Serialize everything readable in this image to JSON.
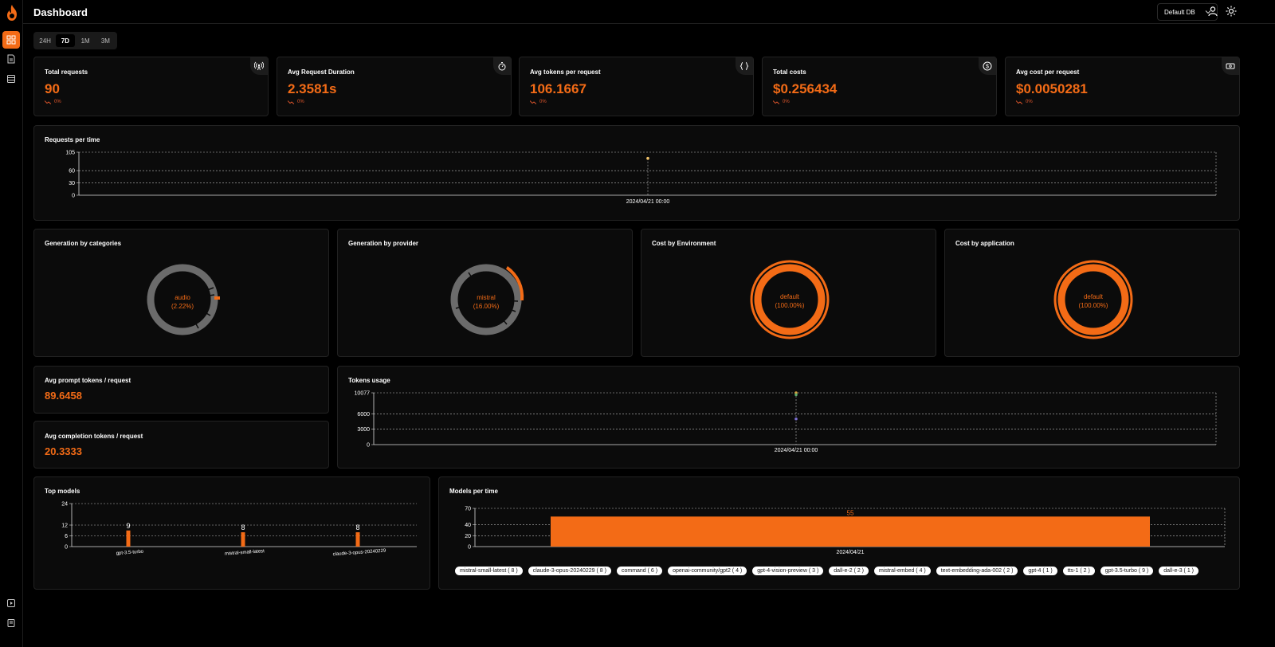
{
  "header": {
    "title": "Dashboard",
    "db_select": "Default DB"
  },
  "time_ranges": [
    {
      "label": "24H",
      "active": false
    },
    {
      "label": "7D",
      "active": true
    },
    {
      "label": "1M",
      "active": false
    },
    {
      "label": "3M",
      "active": false
    }
  ],
  "stats": [
    {
      "title": "Total requests",
      "value": "90",
      "change": "0%",
      "icon": "broadcast-icon"
    },
    {
      "title": "Avg Request Duration",
      "value": "2.3581s",
      "change": "0%",
      "icon": "stopwatch-icon"
    },
    {
      "title": "Avg tokens per request",
      "value": "106.1667",
      "change": "0%",
      "icon": "braces-icon"
    },
    {
      "title": "Total costs",
      "value": "$0.256434",
      "change": "0%",
      "icon": "dollar-icon"
    },
    {
      "title": "Avg cost per request",
      "value": "$0.0050281",
      "change": "0%",
      "icon": "cash-icon"
    }
  ],
  "requests_chart": {
    "title": "Requests per time"
  },
  "donuts": [
    {
      "title": "Generation by categories",
      "label": "audio",
      "pct": "(2.22%)"
    },
    {
      "title": "Generation by provider",
      "label": "mistral",
      "pct": "(16.00%)"
    },
    {
      "title": "Cost by Environment",
      "label": "default",
      "pct": "(100.00%)"
    },
    {
      "title": "Cost by application",
      "label": "default",
      "pct": "(100.00%)"
    }
  ],
  "avg_prompt": {
    "title": "Avg prompt tokens / request",
    "value": "89.6458"
  },
  "avg_completion": {
    "title": "Avg completion tokens / request",
    "value": "20.3333"
  },
  "tokens_chart": {
    "title": "Tokens usage"
  },
  "top_models_title": "Top models",
  "models_per_time_title": "Models per time",
  "models_tags": [
    "mistral-small-latest ( 8 )",
    "claude-3-opus-20240229 ( 8 )",
    "command ( 6 )",
    "openai-community/gpt2 ( 4 )",
    "gpt-4-vision-preview ( 3 )",
    "dall-e-2 ( 2 )",
    "mistral-embed ( 4 )",
    "text-embedding-ada-002 ( 2 )",
    "gpt-4 ( 1 )",
    "tts-1 ( 2 )",
    "gpt-3.5-turbo ( 9 )",
    "dall-e-3 ( 1 )"
  ],
  "colors": {
    "accent": "#f36b16",
    "bg": "#000000",
    "card": "#0b0b0b",
    "muted": "#6b6b6b"
  },
  "chart_data": [
    {
      "type": "scatter",
      "title": "Requests per time",
      "x": [
        "2024/04/21 00:00"
      ],
      "y_ticks": [
        0,
        30,
        60,
        105
      ],
      "ylim": [
        0,
        105
      ],
      "series": [
        {
          "values": [
            90
          ]
        }
      ],
      "grid": true
    },
    {
      "type": "scatter",
      "title": "Tokens usage",
      "x": [
        "2024/04/21 00:00"
      ],
      "y_ticks": [
        0,
        3000,
        6000,
        10077
      ],
      "ylim": [
        0,
        10077
      ],
      "series": [
        {
          "values": [
            10077
          ],
          "color": "#d9a441"
        },
        {
          "values": [
            9700
          ],
          "color": "#5fae6e"
        },
        {
          "values": [
            5000
          ],
          "color": "#7b6fd1"
        }
      ],
      "grid": true
    },
    {
      "type": "bar",
      "title": "Top models",
      "categories": [
        "gpt-3.5-turbo",
        "mistral-small-latest",
        "claude-3-opus-20240229"
      ],
      "values": [
        9,
        8,
        8
      ],
      "y_ticks": [
        0,
        6,
        12,
        24
      ],
      "ylim": [
        0,
        24
      ]
    },
    {
      "type": "bar",
      "title": "Models per time",
      "categories": [
        "2024/04/21"
      ],
      "values": [
        55
      ],
      "y_ticks": [
        0,
        20,
        40,
        70
      ],
      "ylim": [
        0,
        70
      ]
    }
  ]
}
